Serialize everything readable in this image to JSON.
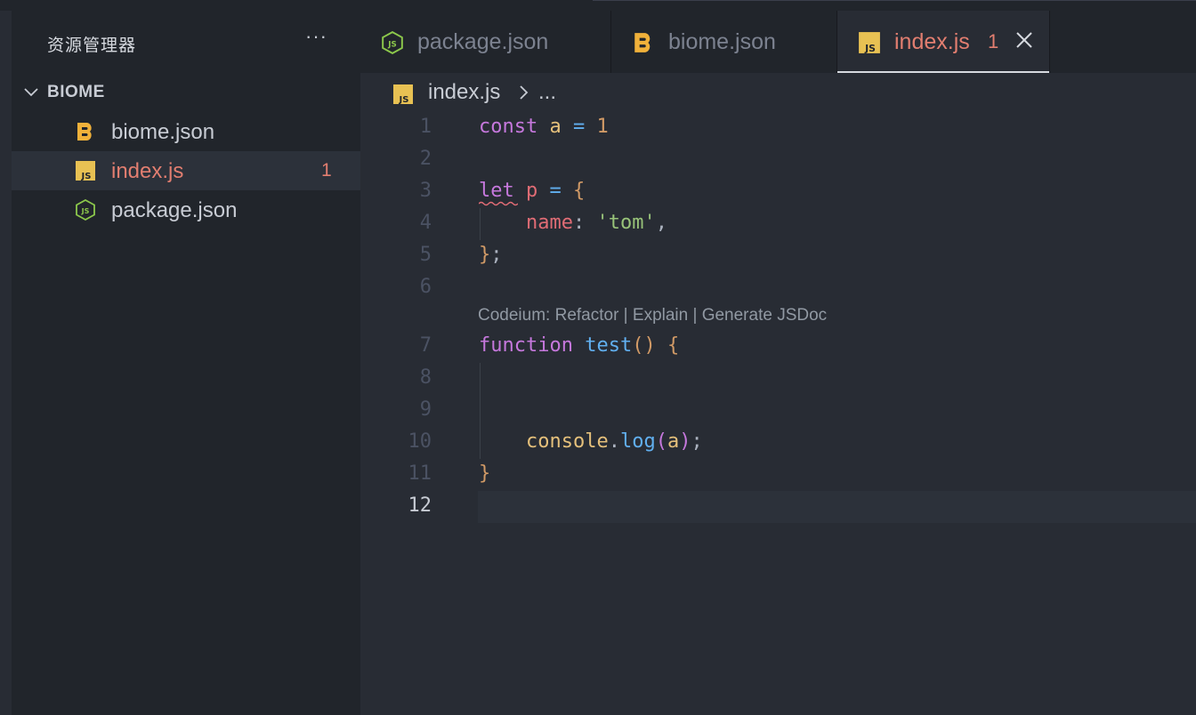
{
  "explorer": {
    "title": "资源管理器",
    "more_label": "···",
    "folder": "BIOME",
    "files": [
      {
        "name": "biome.json",
        "icon": "biome-icon"
      },
      {
        "name": "index.js",
        "icon": "js-icon",
        "badge": "1"
      },
      {
        "name": "package.json",
        "icon": "nodejs-icon"
      }
    ]
  },
  "tabs": [
    {
      "label": "package.json",
      "icon": "nodejs-icon"
    },
    {
      "label": "biome.json",
      "icon": "biome-icon"
    },
    {
      "label": "index.js",
      "icon": "js-icon",
      "badge": "1",
      "active": true
    }
  ],
  "breadcrumb": {
    "file": "index.js",
    "ellipsis": "..."
  },
  "editor": {
    "line_numbers": [
      "1",
      "2",
      "3",
      "4",
      "5",
      "6",
      "7",
      "8",
      "9",
      "10",
      "11",
      "12"
    ],
    "active_line": "12",
    "codelens": "Codeium: Refactor | Explain | Generate JSDoc",
    "code": {
      "l1": {
        "kw": "const",
        "name": "a",
        "op": "=",
        "num": "1"
      },
      "l3": {
        "kw": "let",
        "name": "p",
        "op": "=",
        "brace": "{"
      },
      "l4": {
        "prop": "name",
        "colon": ":",
        "str": "'tom'",
        "comma": ","
      },
      "l5": {
        "brace": "}",
        "semi": ";"
      },
      "l7": {
        "kw": "function",
        "fn": "test",
        "parens": "()",
        "brace": "{"
      },
      "l10": {
        "obj": "console",
        "dot": ".",
        "method": "log",
        "open": "(",
        "arg": "a",
        "close": ")",
        "semi": ";"
      },
      "l11": {
        "brace": "}"
      }
    }
  },
  "colors": {
    "error": "#e27e70",
    "background": "#282c34",
    "sidebar": "#21252b"
  }
}
